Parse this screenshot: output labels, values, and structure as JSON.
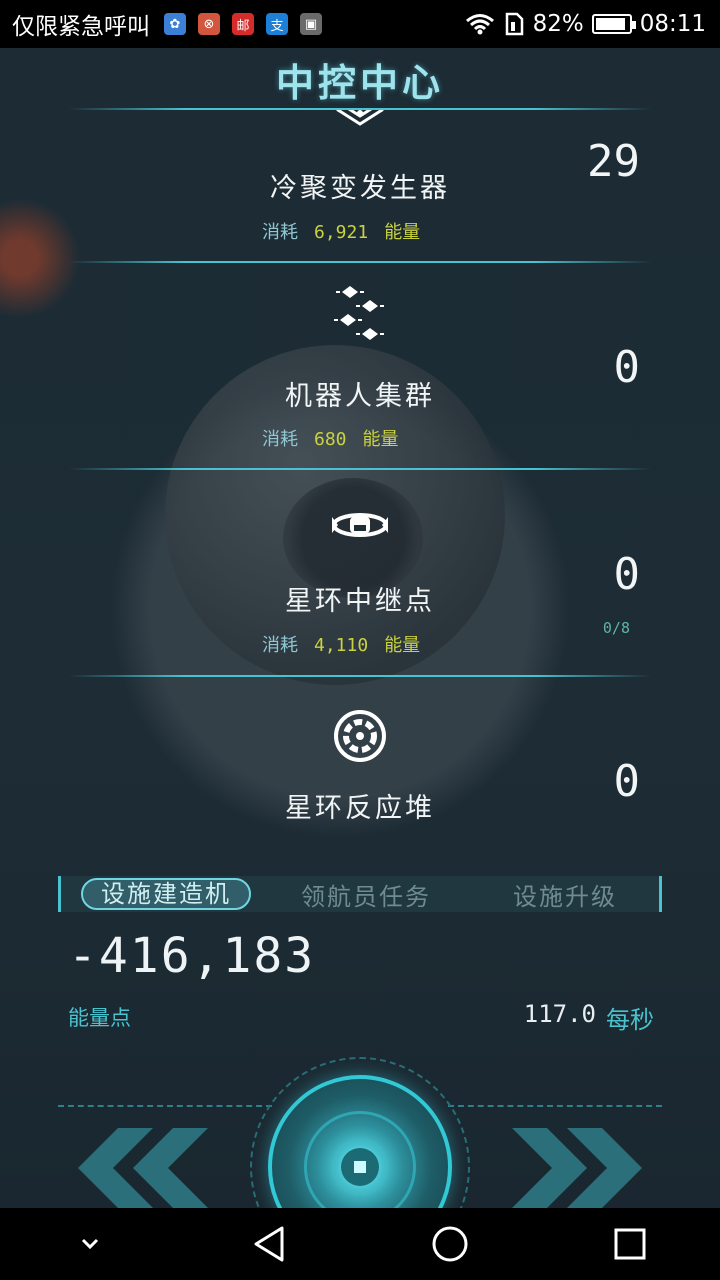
{
  "status_bar": {
    "carrier": "仅限紧急呼叫",
    "apps": [
      {
        "icon": "app-blue-icon",
        "glyph": "✿",
        "color": "#3b7fd6"
      },
      {
        "icon": "app-red-circle-icon",
        "glyph": "⊗",
        "color": "#d2553d"
      },
      {
        "icon": "app-mail-icon",
        "glyph": "邮",
        "color": "#d52b2b"
      },
      {
        "icon": "app-alipay-icon",
        "glyph": "支",
        "color": "#1d7fd6"
      },
      {
        "icon": "app-gallery-icon",
        "glyph": "▣",
        "color": "#6a6a6a"
      }
    ],
    "battery": "82%",
    "time": "08:11"
  },
  "title": "中控中心",
  "facilities": [
    {
      "name": "冷聚变发生器",
      "cost_label": "消耗",
      "cost_value": "6,921",
      "cost_unit": "能量",
      "count": "29",
      "icon": "cold-fusion-icon"
    },
    {
      "name": "机器人集群",
      "cost_label": "消耗",
      "cost_value": "680",
      "cost_unit": "能量",
      "count": "0",
      "icon": "robot-swarm-icon"
    },
    {
      "name": "星环中继点",
      "cost_label": "消耗",
      "cost_value": "4,110",
      "cost_unit": "能量",
      "count": "0",
      "capacity": "0/8",
      "icon": "star-ring-relay-icon"
    },
    {
      "name": "星环反应堆",
      "count": "0",
      "icon": "star-ring-reactor-icon"
    }
  ],
  "tabs": [
    {
      "label": "设施建造机",
      "active": true
    },
    {
      "label": "领航员任务",
      "active": false
    },
    {
      "label": "设施升级",
      "active": false
    }
  ],
  "energy": {
    "value": "-416,183",
    "label": "能量点",
    "rate_value": "117.0",
    "rate_unit": "每秒"
  },
  "colors": {
    "accent": "#49c3cf",
    "cost": "#c9d23f",
    "background": "#1b2a33"
  }
}
